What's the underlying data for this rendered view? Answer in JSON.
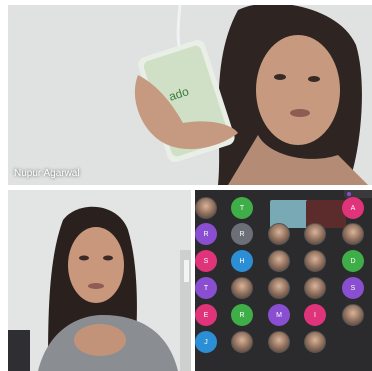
{
  "meeting": {
    "speaker_name": "Nupur Agarwal"
  },
  "gallery": {
    "cells": [
      {
        "row": 0,
        "col": 0,
        "kind": "photo",
        "color": "#6b5b5b",
        "label": ""
      },
      {
        "row": 0,
        "col": 1,
        "kind": "initial",
        "color": "#3fae48",
        "label": "T"
      },
      {
        "row": 0,
        "col": 2,
        "kind": "video",
        "color": "#7aa9b6",
        "label": ""
      },
      {
        "row": 0,
        "col": 3,
        "kind": "video",
        "color": "#5c2b2b",
        "label": ""
      },
      {
        "row": 0,
        "col": 4,
        "kind": "initial",
        "color": "#e0347a",
        "label": "A"
      },
      {
        "row": 1,
        "col": 0,
        "kind": "initial",
        "color": "#8a4fd1",
        "label": "R"
      },
      {
        "row": 1,
        "col": 1,
        "kind": "initial",
        "color": "#6c6f78",
        "label": "R"
      },
      {
        "row": 1,
        "col": 2,
        "kind": "photo",
        "color": "#8a6a58",
        "label": ""
      },
      {
        "row": 1,
        "col": 3,
        "kind": "photo",
        "color": "#8a6a58",
        "label": ""
      },
      {
        "row": 1,
        "col": 4,
        "kind": "photo",
        "color": "#8a6a58",
        "label": ""
      },
      {
        "row": 2,
        "col": 0,
        "kind": "initial",
        "color": "#e0347a",
        "label": "S"
      },
      {
        "row": 2,
        "col": 1,
        "kind": "initial",
        "color": "#2c8fd6",
        "label": "H"
      },
      {
        "row": 2,
        "col": 2,
        "kind": "photo",
        "color": "#8a6a58",
        "label": ""
      },
      {
        "row": 2,
        "col": 3,
        "kind": "photo",
        "color": "#8a6a58",
        "label": ""
      },
      {
        "row": 2,
        "col": 4,
        "kind": "initial",
        "color": "#3fae48",
        "label": "D"
      },
      {
        "row": 3,
        "col": 0,
        "kind": "initial",
        "color": "#8a4fd1",
        "label": "T"
      },
      {
        "row": 3,
        "col": 1,
        "kind": "photo",
        "color": "#8a6a58",
        "label": ""
      },
      {
        "row": 3,
        "col": 2,
        "kind": "photo",
        "color": "#8a6a58",
        "label": ""
      },
      {
        "row": 3,
        "col": 3,
        "kind": "photo",
        "color": "#8a6a58",
        "label": ""
      },
      {
        "row": 3,
        "col": 4,
        "kind": "initial",
        "color": "#8a4fd1",
        "label": "S"
      },
      {
        "row": 4,
        "col": 0,
        "kind": "initial",
        "color": "#e0347a",
        "label": "E"
      },
      {
        "row": 4,
        "col": 1,
        "kind": "initial",
        "color": "#3fae48",
        "label": "R"
      },
      {
        "row": 4,
        "col": 2,
        "kind": "initial",
        "color": "#8a4fd1",
        "label": "M"
      },
      {
        "row": 4,
        "col": 3,
        "kind": "initial",
        "color": "#e0347a",
        "label": "I"
      },
      {
        "row": 4,
        "col": 4,
        "kind": "photo",
        "color": "#8a6a58",
        "label": ""
      },
      {
        "row": 5,
        "col": 0,
        "kind": "initial",
        "color": "#2c8fd6",
        "label": "J"
      },
      {
        "row": 5,
        "col": 1,
        "kind": "photo",
        "color": "#8a6a58",
        "label": ""
      },
      {
        "row": 5,
        "col": 2,
        "kind": "photo",
        "color": "#8a6a58",
        "label": ""
      },
      {
        "row": 5,
        "col": 3,
        "kind": "photo",
        "color": "#8a6a58",
        "label": ""
      }
    ]
  }
}
